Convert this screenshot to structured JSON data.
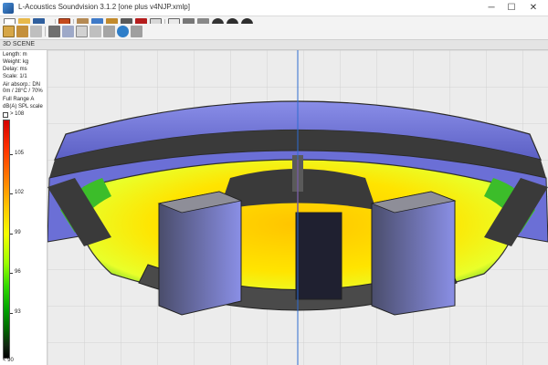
{
  "window": {
    "title": "L-Acoustics Soundvision 3.1.2 [one plus v4NJP.xmlp]",
    "minimize_glyph": "─",
    "maximize_glyph": "☐",
    "close_glyph": "✕"
  },
  "panel": {
    "tab_label": "3D SCENE"
  },
  "legend": {
    "units": [
      "Length: m",
      "Weight: kg",
      "Delay: ms",
      "Scale: 1/1"
    ],
    "air_absorption": "Air absorp.: DN",
    "conditions": "0m / 28°C / 70%",
    "mapping": "Full Range A",
    "scale_title": "dB(A) SPL scale",
    "over_label": "> 108",
    "under_label": "< 90",
    "ticks": [
      {
        "label": "105"
      },
      {
        "label": "102"
      },
      {
        "label": "99"
      },
      {
        "label": "96"
      },
      {
        "label": "93"
      }
    ]
  },
  "colors": {
    "seat_high": "#ffd400",
    "seat_mid": "#ffe86a",
    "seat_edge": "#3cbd2a",
    "speaker_box": "#3c3e52",
    "speaker_side": "#7c80d8",
    "upper_tier": "#6b6fd6",
    "structure": "#3a3a3a"
  },
  "toolbar": {
    "icons": [
      "new-file",
      "open-folder",
      "save",
      "save-dropdown",
      "print",
      "sources",
      "measure",
      "cluster-view",
      "color-swatch",
      "export",
      "grid-view",
      "capture",
      "help",
      "settings"
    ]
  }
}
